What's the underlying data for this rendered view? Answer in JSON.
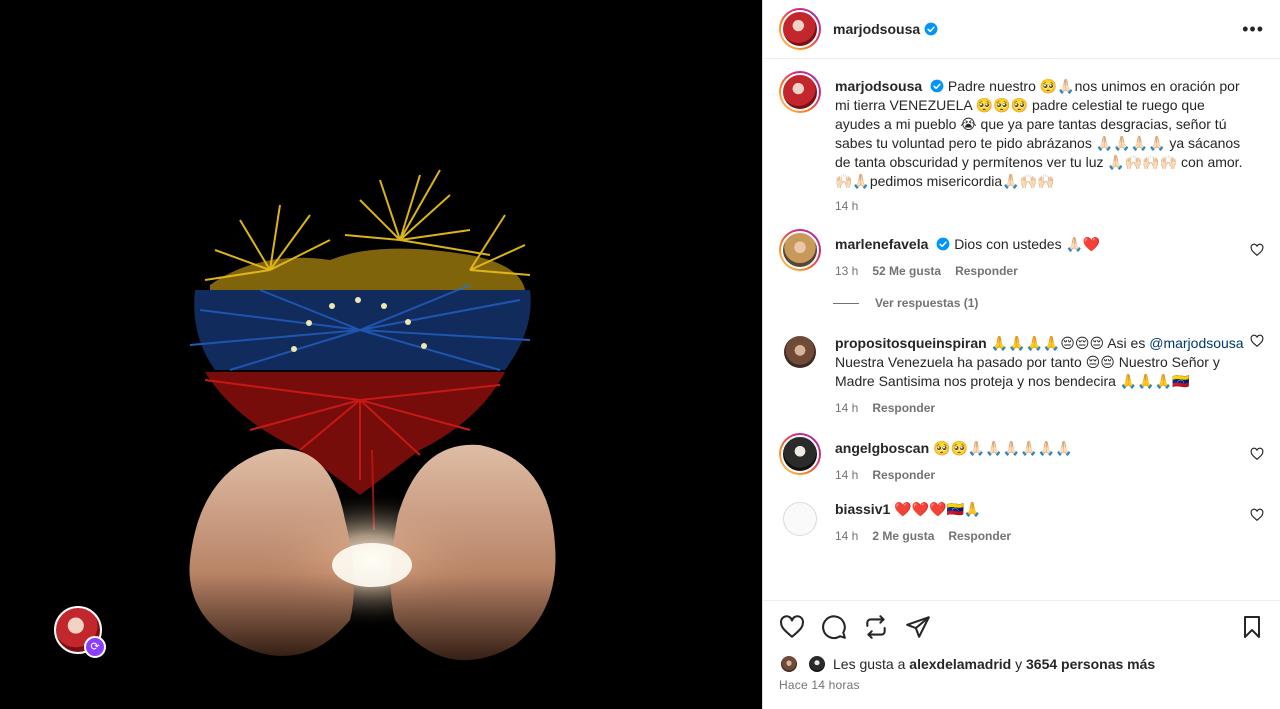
{
  "post": {
    "author": "marjodsousa",
    "more_label": "•••",
    "caption": "Padre nuestro 🥺🙏🏻nos unimos en oración por mi tierra VENEZUELA 🥺🥺🥺 padre celestial te ruego que ayudes a mi pueblo 😭 que ya pare tantas desgracias, señor tú sabes tu voluntad pero te pido abrázanos 🙏🏻🙏🏻🙏🏻🙏🏻 ya sácanos de tanta obscuridad y permítenos ver tu luz 🙏🏻🙌🏻🙌🏻🙌🏻 con amor. 🙌🏻🙏🏻pedimos misericordia🙏🏻🙌🏻🙌🏻",
    "caption_time": "14 h"
  },
  "comments": [
    {
      "user": "marlenefavela",
      "verified": true,
      "text": "Dios con ustedes 🙏🏻❤️",
      "time": "13 h",
      "likes": "52 Me gusta",
      "reply": "Responder",
      "view_replies": "Ver respuestas (1)"
    },
    {
      "user": "propositosqueinspiran",
      "text_pre": "🙏🙏🙏🙏😔😔😔 Asi es",
      "mention": "@marjodsousa",
      "text_post": "Nuestra Venezuela ha pasado por tanto 😔😔 Nuestro Señor y Madre Santisima nos proteja y nos bendecira 🙏🙏🙏🇻🇪",
      "time": "14 h",
      "reply": "Responder"
    },
    {
      "user": "angelgboscan",
      "text": "🥺🥺🙏🏻🙏🏻🙏🏻🙏🏻🙏🏻🙏🏻",
      "time": "14 h",
      "reply": "Responder"
    },
    {
      "user": "biassiv1",
      "text": "❤️❤️❤️🇻🇪🙏",
      "time": "14 h",
      "likes": "2 Me gusta",
      "reply": "Responder"
    }
  ],
  "footer": {
    "likes_prefix": "Les gusta a",
    "likes_user": "alexdelamadrid",
    "likes_and": "y",
    "likes_others": "3654 personas más",
    "time_ago": "Hace 14 horas"
  },
  "icons": {
    "like": "heart-icon",
    "comment": "comment-icon",
    "repost": "repost-icon",
    "share": "share-icon",
    "save": "bookmark-icon",
    "verified": "verified-badge-icon"
  },
  "colors": {
    "verified_blue": "#0095f6",
    "secondary_text": "#737373",
    "link": "#00376b"
  }
}
